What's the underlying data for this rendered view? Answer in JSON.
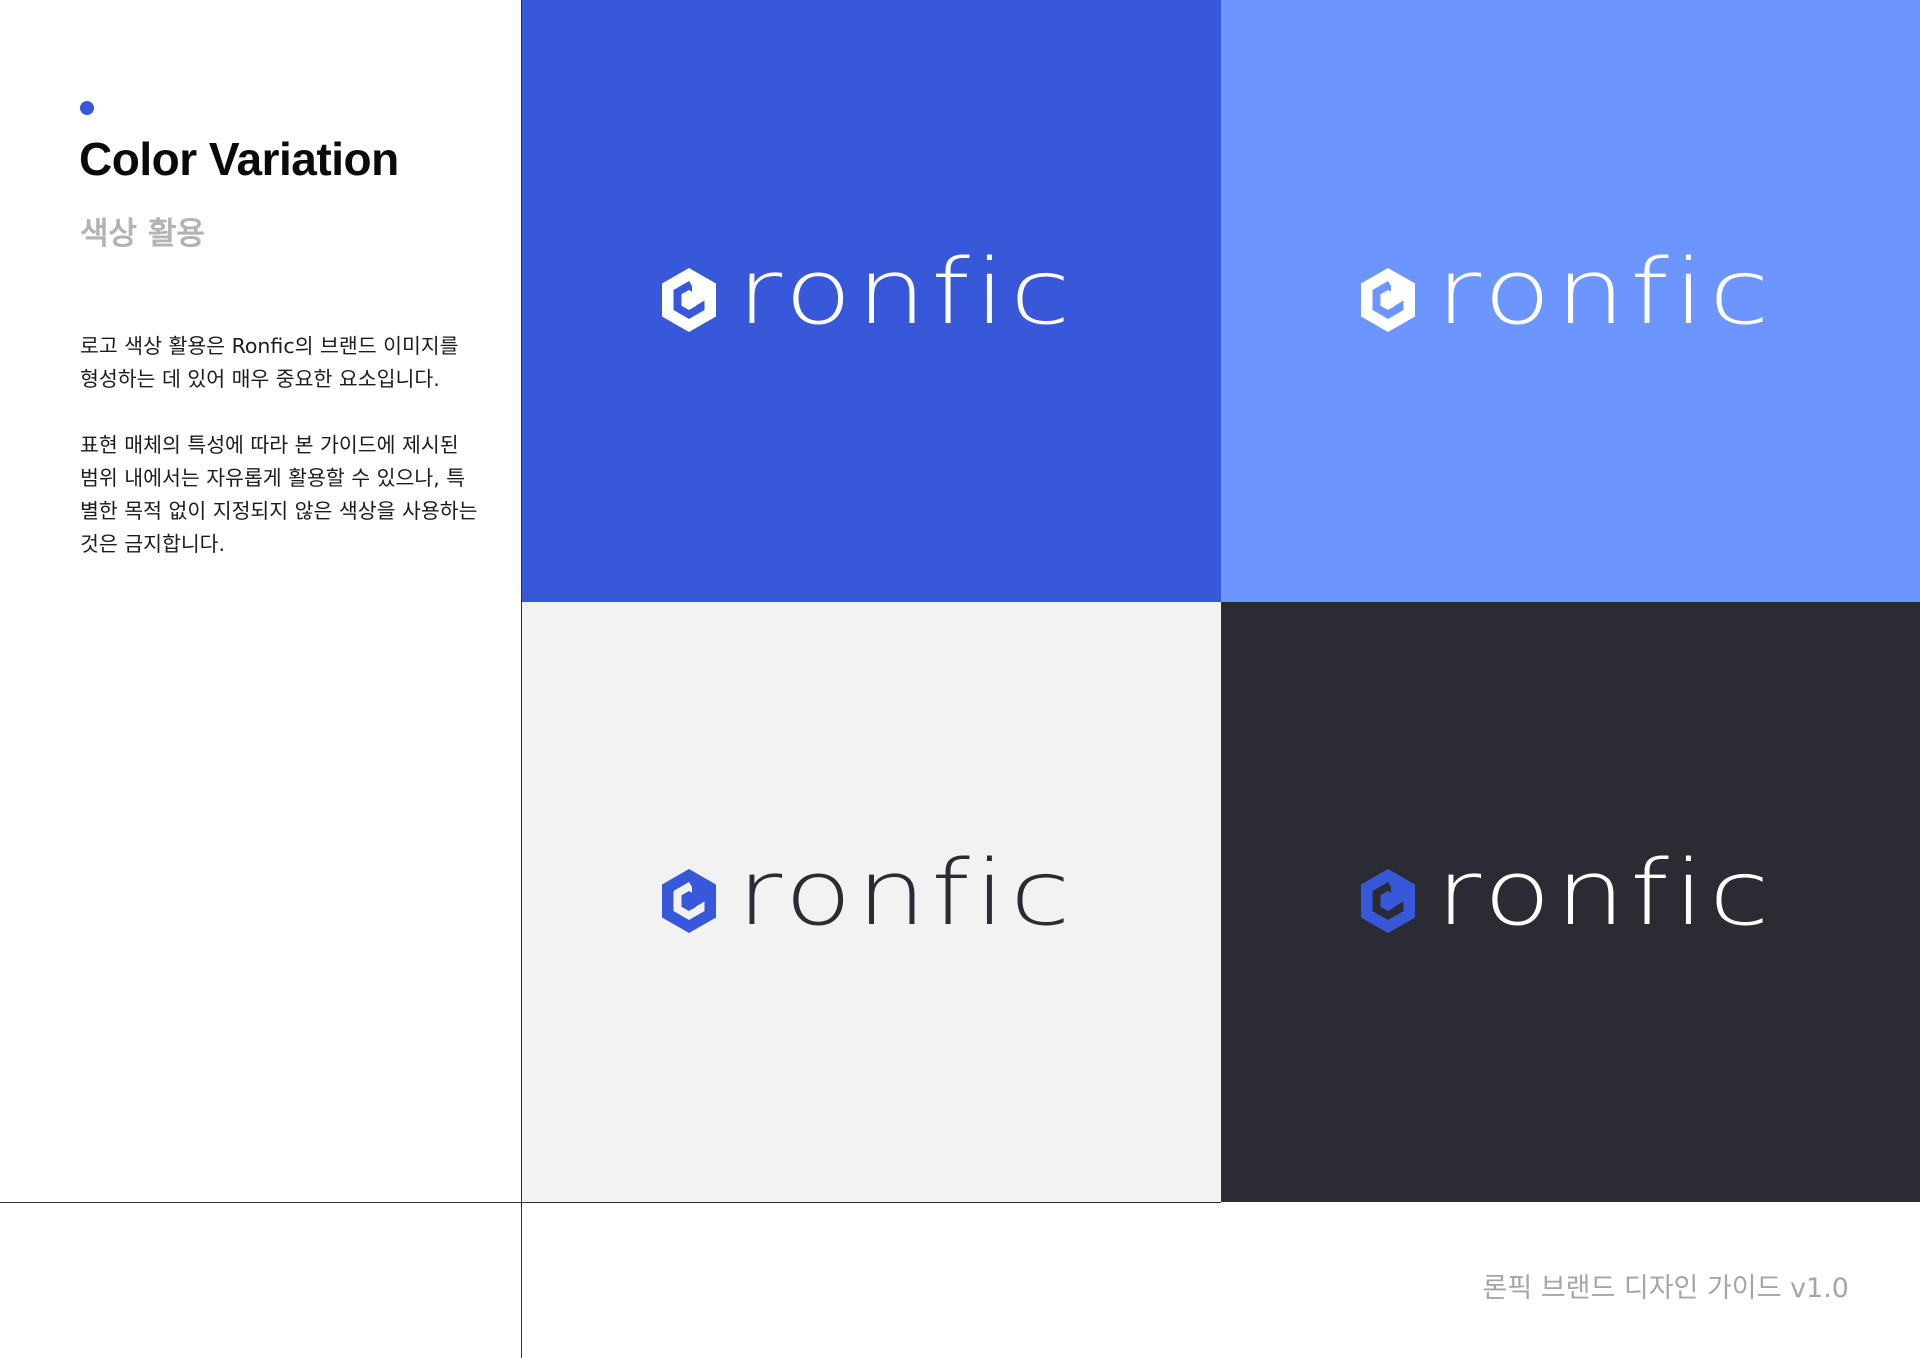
{
  "heading": {
    "title": "Color Variation",
    "subtitle": "색상 활용"
  },
  "description": {
    "paragraph_1": "로고 색상 활용은 Ronfic의 브랜드 이미지를 형성하는 데 있어 매우 중요한 요소입니다.",
    "paragraph_2": "표현 매체의 특성에 따라 본 가이드에 제시된 범위 내에서는 자유롭게 활용할 수 있으나, 특별한 목적 없이 지정되지 않은 색상을 사용하는 것은 금지합니다."
  },
  "logo": {
    "wordmark": "ronfic",
    "icon": "hexagon-logo-icon"
  },
  "panels": [
    {
      "background": "#3758d9",
      "mark_color": "#ffffff",
      "text_color": "#ffffff"
    },
    {
      "background": "#6c95ff",
      "mark_color": "#ffffff",
      "text_color": "#ffffff"
    },
    {
      "background": "#f2f2f2",
      "mark_color": "#3758d9",
      "text_color": "#2b2b33"
    },
    {
      "background": "#2b2b33",
      "mark_color": "#3758d9",
      "text_color": "#ffffff"
    }
  ],
  "colors": {
    "accent_dot": "#3758d9",
    "divider": "#2d2e36"
  },
  "footer": {
    "text": "론픽 브랜드 디자인 가이드 v1.0"
  }
}
